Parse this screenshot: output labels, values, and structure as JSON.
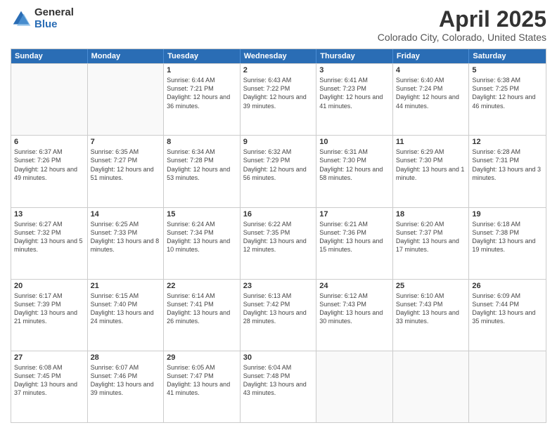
{
  "header": {
    "logo_general": "General",
    "logo_blue": "Blue",
    "month_title": "April 2025",
    "location": "Colorado City, Colorado, United States"
  },
  "weekdays": [
    "Sunday",
    "Monday",
    "Tuesday",
    "Wednesday",
    "Thursday",
    "Friday",
    "Saturday"
  ],
  "rows": [
    [
      {
        "day": "",
        "sunrise": "",
        "sunset": "",
        "daylight": ""
      },
      {
        "day": "",
        "sunrise": "",
        "sunset": "",
        "daylight": ""
      },
      {
        "day": "1",
        "sunrise": "Sunrise: 6:44 AM",
        "sunset": "Sunset: 7:21 PM",
        "daylight": "Daylight: 12 hours and 36 minutes."
      },
      {
        "day": "2",
        "sunrise": "Sunrise: 6:43 AM",
        "sunset": "Sunset: 7:22 PM",
        "daylight": "Daylight: 12 hours and 39 minutes."
      },
      {
        "day": "3",
        "sunrise": "Sunrise: 6:41 AM",
        "sunset": "Sunset: 7:23 PM",
        "daylight": "Daylight: 12 hours and 41 minutes."
      },
      {
        "day": "4",
        "sunrise": "Sunrise: 6:40 AM",
        "sunset": "Sunset: 7:24 PM",
        "daylight": "Daylight: 12 hours and 44 minutes."
      },
      {
        "day": "5",
        "sunrise": "Sunrise: 6:38 AM",
        "sunset": "Sunset: 7:25 PM",
        "daylight": "Daylight: 12 hours and 46 minutes."
      }
    ],
    [
      {
        "day": "6",
        "sunrise": "Sunrise: 6:37 AM",
        "sunset": "Sunset: 7:26 PM",
        "daylight": "Daylight: 12 hours and 49 minutes."
      },
      {
        "day": "7",
        "sunrise": "Sunrise: 6:35 AM",
        "sunset": "Sunset: 7:27 PM",
        "daylight": "Daylight: 12 hours and 51 minutes."
      },
      {
        "day": "8",
        "sunrise": "Sunrise: 6:34 AM",
        "sunset": "Sunset: 7:28 PM",
        "daylight": "Daylight: 12 hours and 53 minutes."
      },
      {
        "day": "9",
        "sunrise": "Sunrise: 6:32 AM",
        "sunset": "Sunset: 7:29 PM",
        "daylight": "Daylight: 12 hours and 56 minutes."
      },
      {
        "day": "10",
        "sunrise": "Sunrise: 6:31 AM",
        "sunset": "Sunset: 7:30 PM",
        "daylight": "Daylight: 12 hours and 58 minutes."
      },
      {
        "day": "11",
        "sunrise": "Sunrise: 6:29 AM",
        "sunset": "Sunset: 7:30 PM",
        "daylight": "Daylight: 13 hours and 1 minute."
      },
      {
        "day": "12",
        "sunrise": "Sunrise: 6:28 AM",
        "sunset": "Sunset: 7:31 PM",
        "daylight": "Daylight: 13 hours and 3 minutes."
      }
    ],
    [
      {
        "day": "13",
        "sunrise": "Sunrise: 6:27 AM",
        "sunset": "Sunset: 7:32 PM",
        "daylight": "Daylight: 13 hours and 5 minutes."
      },
      {
        "day": "14",
        "sunrise": "Sunrise: 6:25 AM",
        "sunset": "Sunset: 7:33 PM",
        "daylight": "Daylight: 13 hours and 8 minutes."
      },
      {
        "day": "15",
        "sunrise": "Sunrise: 6:24 AM",
        "sunset": "Sunset: 7:34 PM",
        "daylight": "Daylight: 13 hours and 10 minutes."
      },
      {
        "day": "16",
        "sunrise": "Sunrise: 6:22 AM",
        "sunset": "Sunset: 7:35 PM",
        "daylight": "Daylight: 13 hours and 12 minutes."
      },
      {
        "day": "17",
        "sunrise": "Sunrise: 6:21 AM",
        "sunset": "Sunset: 7:36 PM",
        "daylight": "Daylight: 13 hours and 15 minutes."
      },
      {
        "day": "18",
        "sunrise": "Sunrise: 6:20 AM",
        "sunset": "Sunset: 7:37 PM",
        "daylight": "Daylight: 13 hours and 17 minutes."
      },
      {
        "day": "19",
        "sunrise": "Sunrise: 6:18 AM",
        "sunset": "Sunset: 7:38 PM",
        "daylight": "Daylight: 13 hours and 19 minutes."
      }
    ],
    [
      {
        "day": "20",
        "sunrise": "Sunrise: 6:17 AM",
        "sunset": "Sunset: 7:39 PM",
        "daylight": "Daylight: 13 hours and 21 minutes."
      },
      {
        "day": "21",
        "sunrise": "Sunrise: 6:15 AM",
        "sunset": "Sunset: 7:40 PM",
        "daylight": "Daylight: 13 hours and 24 minutes."
      },
      {
        "day": "22",
        "sunrise": "Sunrise: 6:14 AM",
        "sunset": "Sunset: 7:41 PM",
        "daylight": "Daylight: 13 hours and 26 minutes."
      },
      {
        "day": "23",
        "sunrise": "Sunrise: 6:13 AM",
        "sunset": "Sunset: 7:42 PM",
        "daylight": "Daylight: 13 hours and 28 minutes."
      },
      {
        "day": "24",
        "sunrise": "Sunrise: 6:12 AM",
        "sunset": "Sunset: 7:43 PM",
        "daylight": "Daylight: 13 hours and 30 minutes."
      },
      {
        "day": "25",
        "sunrise": "Sunrise: 6:10 AM",
        "sunset": "Sunset: 7:43 PM",
        "daylight": "Daylight: 13 hours and 33 minutes."
      },
      {
        "day": "26",
        "sunrise": "Sunrise: 6:09 AM",
        "sunset": "Sunset: 7:44 PM",
        "daylight": "Daylight: 13 hours and 35 minutes."
      }
    ],
    [
      {
        "day": "27",
        "sunrise": "Sunrise: 6:08 AM",
        "sunset": "Sunset: 7:45 PM",
        "daylight": "Daylight: 13 hours and 37 minutes."
      },
      {
        "day": "28",
        "sunrise": "Sunrise: 6:07 AM",
        "sunset": "Sunset: 7:46 PM",
        "daylight": "Daylight: 13 hours and 39 minutes."
      },
      {
        "day": "29",
        "sunrise": "Sunrise: 6:05 AM",
        "sunset": "Sunset: 7:47 PM",
        "daylight": "Daylight: 13 hours and 41 minutes."
      },
      {
        "day": "30",
        "sunrise": "Sunrise: 6:04 AM",
        "sunset": "Sunset: 7:48 PM",
        "daylight": "Daylight: 13 hours and 43 minutes."
      },
      {
        "day": "",
        "sunrise": "",
        "sunset": "",
        "daylight": ""
      },
      {
        "day": "",
        "sunrise": "",
        "sunset": "",
        "daylight": ""
      },
      {
        "day": "",
        "sunrise": "",
        "sunset": "",
        "daylight": ""
      }
    ]
  ]
}
